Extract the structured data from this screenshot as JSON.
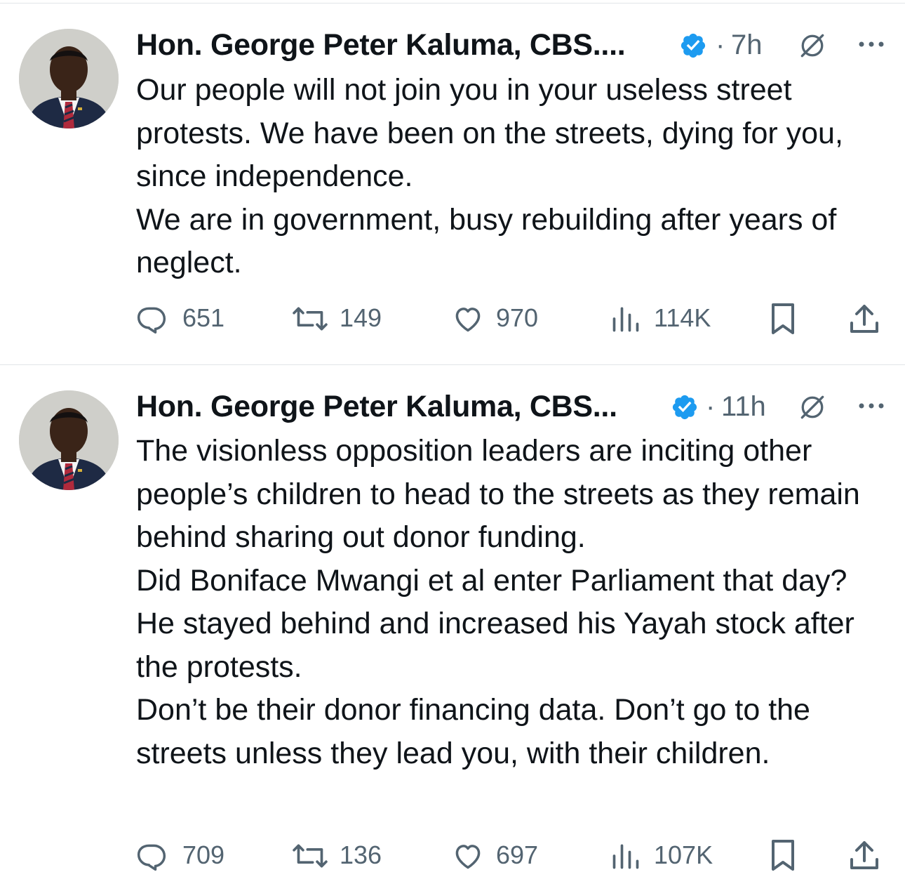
{
  "tweets": [
    {
      "author": "Hon. George Peter Kaluma, CBS....",
      "separator": "·",
      "time": "7h",
      "text": "Our people will not join you in your useless street protests. We have been on the streets, dying for you, since independence.\nWe are in government, busy rebuilding after years of neglect.",
      "replies": "651",
      "retweets": "149",
      "likes": "970",
      "views": "114K"
    },
    {
      "author": "Hon. George Peter Kaluma, CBS...",
      "separator": "·",
      "time": "11h",
      "text": "The visionless opposition leaders are inciting other people’s children to head to the streets as they remain behind sharing out donor funding.\nDid Boniface Mwangi et al enter Parliament that day? He stayed behind and increased his Yayah stock after the protests.\nDon’t be their donor financing data. Don’t go to the streets unless they lead you, with their children.",
      "replies": "709",
      "retweets": "136",
      "likes": "697",
      "views": "107K"
    }
  ],
  "icons": {
    "verified": "verified-badge-icon",
    "grok": "grok-icon",
    "more": "more-icon",
    "reply": "reply-icon",
    "retweet": "retweet-icon",
    "like": "like-icon",
    "views": "views-icon",
    "bookmark": "bookmark-icon",
    "share": "share-icon"
  },
  "colors": {
    "text": "#0f1419",
    "secondary": "#536471",
    "verified": "#1d9bf0",
    "divider": "#e1e5e8"
  }
}
